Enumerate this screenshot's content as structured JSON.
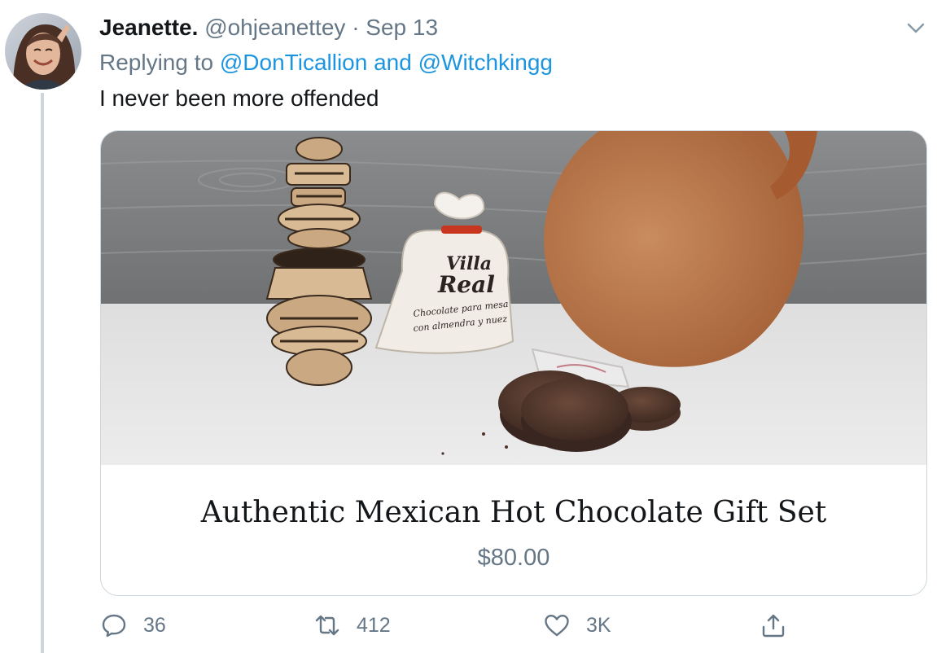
{
  "tweet": {
    "author_name": "Jeanette.",
    "handle": "@ohjeanettey",
    "separator": "·",
    "date": "Sep 13",
    "replying_prefix": "Replying to",
    "mention_1": "@DonTicallion",
    "mention_joiner": "and",
    "mention_2": "@Witchkingg",
    "text": "I never been more offended"
  },
  "card": {
    "title": "Authentic Mexican Hot Chocolate Gift Set",
    "price": "$80.00",
    "bag_text": {
      "brand_1": "Villa",
      "brand_2": "Real",
      "line_1": "Chocolate para mesa",
      "line_2": "con almendra y nuez"
    }
  },
  "actions": {
    "replies": "36",
    "retweets": "412",
    "likes": "3K"
  },
  "icons": {
    "reply": "reply-icon",
    "retweet": "retweet-icon",
    "like": "heart-icon",
    "share": "share-icon",
    "menu": "chevron-down-icon"
  },
  "colors": {
    "link": "#1b95e0",
    "muted": "#657786",
    "text": "#14171a"
  }
}
